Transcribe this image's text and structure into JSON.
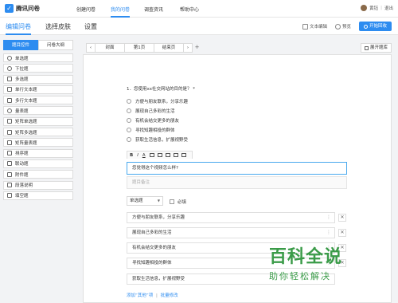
{
  "brand": {
    "name": "腾讯问卷",
    "logo_glyph": "✓"
  },
  "topnav": {
    "items": [
      "创建问卷",
      "我的问卷",
      "调查资讯",
      "帮助中心"
    ],
    "active_index": 1
  },
  "user": {
    "name": "黄钰",
    "logout": "退出"
  },
  "subbar": {
    "items": [
      "编辑问卷",
      "选择皮肤",
      "设置"
    ],
    "active_index": 0,
    "text_edit": "文本编辑",
    "preview": "预览",
    "publish": "开始回收"
  },
  "left": {
    "tabs": [
      "题目控件",
      "问卷大纲"
    ],
    "active_tab": 0,
    "types": [
      {
        "label": "单选题",
        "icon": "radio-icon"
      },
      {
        "label": "下拉题",
        "icon": "dropdown-icon"
      },
      {
        "label": "多选题",
        "icon": "checkbox-icon"
      },
      {
        "label": "单行文本题",
        "icon": "single-line-icon"
      },
      {
        "label": "多行文本题",
        "icon": "multi-line-icon"
      },
      {
        "label": "量表题",
        "icon": "star-icon"
      },
      {
        "label": "矩阵单选题",
        "icon": "matrix-radio-icon"
      },
      {
        "label": "矩阵多选题",
        "icon": "matrix-checkbox-icon"
      },
      {
        "label": "矩阵量表题",
        "icon": "matrix-star-icon"
      },
      {
        "label": "排序题",
        "icon": "sort-icon"
      },
      {
        "label": "联动题",
        "icon": "link-icon"
      },
      {
        "label": "附件题",
        "icon": "attachment-icon"
      },
      {
        "label": "段落说明",
        "icon": "paragraph-icon"
      },
      {
        "label": "填空题",
        "icon": "fill-blank-icon"
      }
    ]
  },
  "pages": {
    "tabs": [
      "封面",
      "第1页",
      "结束页"
    ],
    "add": "+",
    "prev": "‹",
    "next": "›",
    "expand": "展开题库"
  },
  "question": {
    "title": "1．您使用xx社交网站的目的是？ *",
    "options": [
      "方便与朋友联系，分享乐趣",
      "展现自己多彩的生活",
      "有机会结交更多的朋友",
      "寻找知趣相投的群体",
      "获取生活信息，扩展视野受"
    ],
    "toolbar": [
      "B",
      "I",
      "A"
    ],
    "edit_value": "您觉得这个视频怎么样?",
    "note_placeholder": "题目备注",
    "type": "单选题",
    "required_label": "必填",
    "edit_options": [
      "方便与朋友联系，分享乐趣",
      "展现自己多彩的生活",
      "有机会结交更多的朋友",
      "寻找知趣相投的群体",
      "获取生活信息，扩展视野受"
    ],
    "add_other": "添加“其他”项",
    "batch_edit": "批量修改",
    "divider": "|"
  },
  "watermark": {
    "title": "百科全说",
    "subtitle": "助你轻松解决"
  },
  "colors": {
    "accent": "#2d8cf0",
    "watermark": "#3a9b48"
  }
}
